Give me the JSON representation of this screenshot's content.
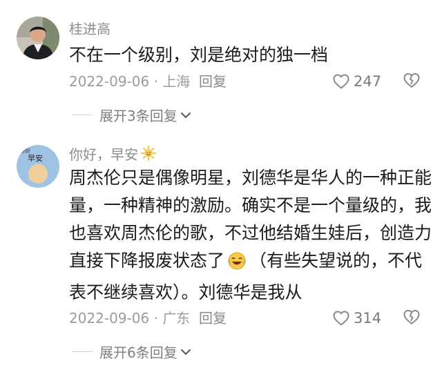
{
  "comments": [
    {
      "username": "桂进高",
      "lines": [
        "不在一个级别，刘是绝对的独一档"
      ],
      "date": "2022-09-06",
      "location": "上海",
      "reply_label": "回复",
      "likes": "247",
      "expand_label": "展开3条回复",
      "avatar_icon": "person-photo-avatar"
    },
    {
      "username": "你好，早安",
      "username_emoji": "sun-emoji",
      "lines": [
        "周杰伦只是偶像明星，刘德华是华人的一种正能",
        "量，一种精神的激励。确实不是一个量级的，我",
        "也喜欢周杰伦的歌，不过他结婚生娃后，创造力",
        "直接下降报废状态了",
        "（有些失望说的，不代",
        "表不继续喜欢）。刘德华是我从"
      ],
      "inline_emoji": "laugh-cry-emoji",
      "date": "2022-09-06",
      "location": "广东",
      "reply_label": "回复",
      "likes": "314",
      "expand_label": "展开6条回复",
      "avatar_icon": "hand-greeting-avatar",
      "avatar_text": [
        "你好",
        "早安"
      ]
    }
  ]
}
